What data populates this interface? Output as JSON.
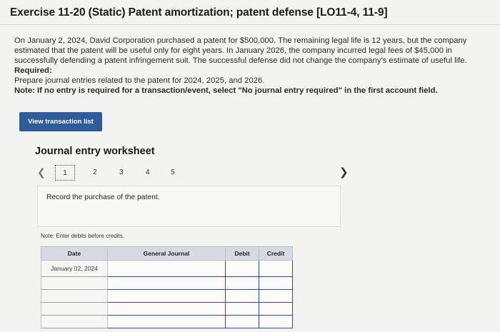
{
  "header": {
    "title": "Exercise 11-20 (Static) Patent amortization; patent defense [LO11-4, 11-9]"
  },
  "problem": {
    "text": "On January 2, 2024, David Corporation purchased a patent for $500,000. The remaining legal life is 12 years, but the company estimated that the patent will be useful only for eight years. In January 2026, the company incurred legal fees of $45,000 in successfully defending a patent infringement suit. The successful defense did not change the company's estimate of useful life.",
    "required_label": "Required:",
    "required_text": "Prepare journal entries related to the patent for 2024, 2025, and 2026.",
    "note_text": "Note: If no entry is required for a transaction/event, select \"No journal entry required\" in the first account field."
  },
  "buttons": {
    "view_transaction_list": "View transaction list"
  },
  "worksheet": {
    "title": "Journal entry worksheet",
    "pages": [
      "1",
      "2",
      "3",
      "4",
      "5"
    ],
    "active_page": "1",
    "prev_icon": "chevron-left-icon",
    "next_icon": "chevron-right-icon",
    "instruction": "Record the purchase of the patent.",
    "note": "Note: Enter debits before credits."
  },
  "journal": {
    "columns": [
      "Date",
      "General Journal",
      "Debit",
      "Credit"
    ],
    "first_date": "January 02, 2024"
  },
  "colors": {
    "button_bg": "#2e5c9a",
    "input_border": "#2d4f86",
    "header_bg": "#d7dbe1"
  }
}
